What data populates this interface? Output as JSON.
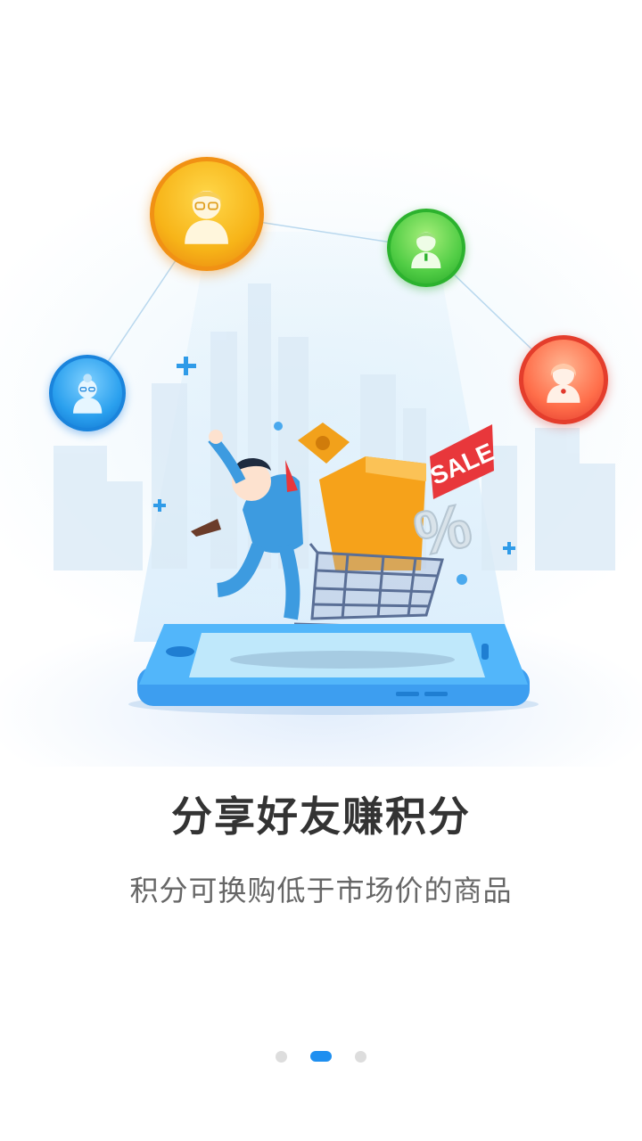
{
  "onboarding": {
    "headline": "分享好友赚积分",
    "subtitle": "积分可换购低于市场价的商品"
  },
  "illustration": {
    "sale_tag": "SALE",
    "percent_sign": "%",
    "avatars": [
      {
        "name": "avatar-orange",
        "color": "#f7b418"
      },
      {
        "name": "avatar-green",
        "color": "#51cd45"
      },
      {
        "name": "avatar-blue",
        "color": "#2aa0ee"
      },
      {
        "name": "avatar-red",
        "color": "#ff6e4a"
      }
    ]
  },
  "pager": {
    "count": 3,
    "active_index": 1,
    "active_color": "#1e8ff0",
    "inactive_color": "#dddddd"
  }
}
